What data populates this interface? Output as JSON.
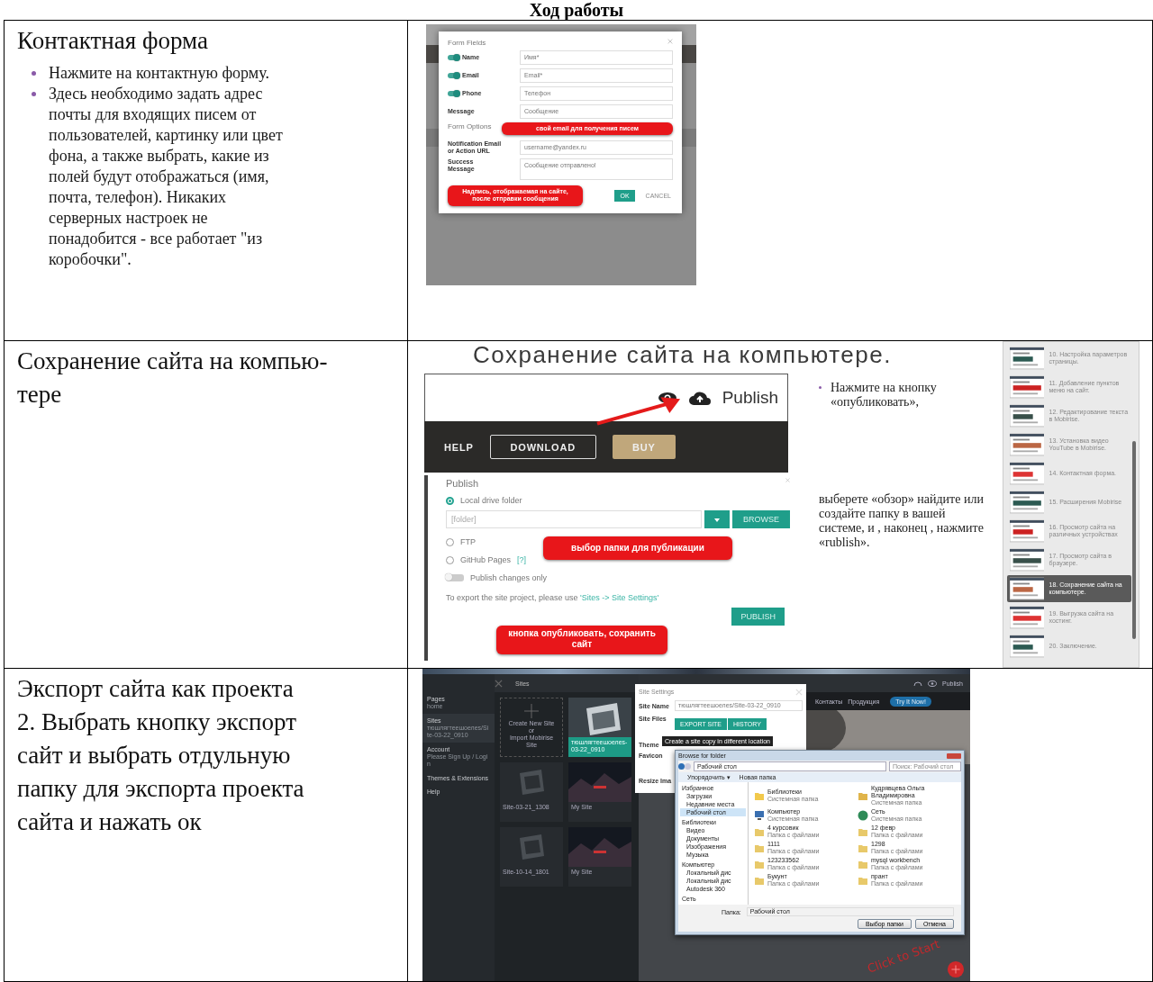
{
  "heading": "Ход работы",
  "contact_row": {
    "title": "Контактная форма",
    "bullets": [
      "Нажмите на контактную форму.",
      "Здесь необходимо задать адрес почты для входящих писем от пользователей, картинку или цвет фона, а также выбрать, какие из полей будут отображаться (имя, почта, телефон). Никаких серверных настроек не понадобится - все работает \"из коробочки\"."
    ],
    "form_dialog": {
      "title": "Form Fields",
      "fields": [
        {
          "kind": "toggle",
          "on": true,
          "label": "Name",
          "value": "Имя*"
        },
        {
          "kind": "toggle",
          "on": true,
          "label": "Email",
          "value": "Email*"
        },
        {
          "kind": "toggle",
          "on": true,
          "label": "Phone",
          "value": "Телефон"
        },
        {
          "kind": "plain",
          "label": "Message",
          "value": "Сообщение"
        }
      ],
      "options_title": "Form Options",
      "notification_label": "Notification Email or Action URL",
      "notification_value": "username@yandex.ru",
      "success_label": "Success Message",
      "success_value": "Сообщение отправлено!",
      "ok": "OK",
      "cancel": "CANCEL"
    },
    "callouts": [
      "свой email для получения писем",
      "Надпись, отображаемая на сайте, после отправки сообщения"
    ]
  },
  "save_row": {
    "title": "Сохранение сайта на компью-\nтере",
    "slide_title": "Сохранение сайта на компьютере.",
    "toolbar_label": "Publish",
    "nav": [
      {
        "kind": "link",
        "label": "HELP"
      },
      {
        "kind": "outline",
        "label": "DOWNLOAD"
      },
      {
        "kind": "filled",
        "label": "BUY"
      }
    ],
    "publish_dialog": {
      "title": "Publish",
      "options": [
        {
          "label": "Local drive folder",
          "selected": true
        },
        {
          "label": "FTP",
          "selected": false
        },
        {
          "label": "GitHub Pages",
          "selected": false,
          "help": "[?]"
        }
      ],
      "folder_placeholder": "[folder]",
      "browse": "BROWSE",
      "changes_only": {
        "label": "Publish changes only",
        "on": false
      },
      "note": "To export the site project, please use ",
      "note_link": "'Sites -> Site Settings'",
      "publish": "PUBLISH"
    },
    "callouts": [
      "выбор папки для публикации",
      "кнопка опубликовать, сохранить сайт"
    ],
    "slide_bullet": "Нажмите на кнопку «опубликовать»,",
    "slide_text": "выберете «обзор» найдите или создайте папку в вашей системе, и , наконец , нажмите «rublish».",
    "slides": [
      {
        "label": "10. Настройка параметров страницы.",
        "selected": false
      },
      {
        "label": "11. Добавление пунктов меню на сайт.",
        "selected": false
      },
      {
        "label": "12. Редактирование текста в Mobirise.",
        "selected": false
      },
      {
        "label": "13. Установка видео YouTube в Mobirise.",
        "selected": false
      },
      {
        "label": "14. Контактная форма.",
        "selected": false
      },
      {
        "label": "15. Расширения Mobirise",
        "selected": false
      },
      {
        "label": "16. Просмотр сайта на различных устройствах",
        "selected": false
      },
      {
        "label": "17. Просмотр сайта в браузере.",
        "selected": false
      },
      {
        "label": "18. Сохранение сайта на компьютере.",
        "selected": true
      },
      {
        "label": "19. Выгрузка сайта на хостинг.",
        "selected": false
      },
      {
        "label": "20. Заключение.",
        "selected": false
      }
    ]
  },
  "export_row": {
    "title": "Экспорт сайта как проекта\n2. Выбрать кнопку экспорт\nсайт и выбрать отдульную\nпапку для экспорта проекта\nсайта и нажать ок",
    "menu": [
      {
        "label": "Pages",
        "sub": "home",
        "selected": false
      },
      {
        "label": "Sites",
        "sub": "тюшлягтеешоелеs/Site-03-22_0910",
        "selected": true
      },
      {
        "label": "Account",
        "sub": "Please Sign Up / Login",
        "selected": false
      },
      {
        "label": "Themes & Extensions",
        "selected": false
      },
      {
        "label": "Help",
        "selected": false
      }
    ],
    "panel_title": "Sites",
    "create_label": "Create New Site",
    "create_or": "or",
    "import_label": "Import Mobirise Site",
    "sites": [
      {
        "kind": "current",
        "name": "тюшлягтеешоелеs-03-22_0910"
      },
      {
        "kind": "blank",
        "name": "Site-03-21_1308"
      },
      {
        "kind": "template",
        "name": "My Site"
      },
      {
        "kind": "blank",
        "name": "Site-10-14_1801"
      },
      {
        "kind": "template",
        "name": "My Site"
      }
    ],
    "topbar_publish": "Publish",
    "site_nav": [
      "Контакты",
      "Продукция"
    ],
    "cta": "Try It Now!",
    "settings": {
      "title": "Site Settings",
      "name_label": "Site Name",
      "name_value": "тюшлягтеешоелеs/Site-03-22_0910",
      "files_label": "Site Files",
      "export": "EXPORT SITE",
      "history": "HISTORY",
      "tooltip": "Create a site copy in different location",
      "theme_label": "Theme",
      "favicon_label": "Favicon",
      "resize_label": "Resize Ima"
    },
    "browse": {
      "title": "Browse for folder",
      "address": "Рабочий стол",
      "search": "Поиск: Рабочий стол",
      "organize": "Упорядочить ▾",
      "new_folder": "Новая папка",
      "tree": [
        {
          "label": "Избранное",
          "selected": false,
          "children": [
            {
              "label": "Загрузки",
              "selected": false
            },
            {
              "label": "Недавние места",
              "selected": false
            },
            {
              "label": "Рабочий стол",
              "selected": true
            }
          ]
        },
        {
          "label": "Библиотеки",
          "selected": false,
          "children": [
            {
              "label": "Видео",
              "selected": false
            },
            {
              "label": "Документы",
              "selected": false
            },
            {
              "label": "Изображения",
              "selected": false
            },
            {
              "label": "Музыка",
              "selected": false
            }
          ]
        },
        {
          "label": "Компьютер",
          "selected": false,
          "children": [
            {
              "label": "Локальный дис",
              "selected": false
            },
            {
              "label": "Локальный дис",
              "selected": false
            },
            {
              "label": "Autodesk 360",
              "selected": false
            }
          ]
        },
        {
          "label": "Сеть",
          "selected": false
        }
      ],
      "items": [
        {
          "kind": "library",
          "name": "Библиотеки",
          "type": "Системная папка"
        },
        {
          "kind": "user",
          "name": "Кудрявцева Ольга Владимировна",
          "type": "Системная папка"
        },
        {
          "kind": "computer",
          "name": "Компьютер",
          "type": "Системная папка"
        },
        {
          "kind": "network",
          "name": "Сеть",
          "type": "Системная папка"
        },
        {
          "kind": "folder",
          "name": "4 курсовик",
          "type": "Папка с файлами"
        },
        {
          "kind": "folder",
          "name": "12 февр",
          "type": "Папка с файлами"
        },
        {
          "kind": "folder",
          "name": "1111",
          "type": "Папка с файлами"
        },
        {
          "kind": "folder",
          "name": "1298",
          "type": "Папка с файлами"
        },
        {
          "kind": "folder",
          "name": "123233562",
          "type": "Папка с файлами"
        },
        {
          "kind": "folder",
          "name": "mysql workbench",
          "type": "Папка с файлами"
        },
        {
          "kind": "folder",
          "name": "Букунт",
          "type": "Папка с файлами"
        },
        {
          "kind": "folder",
          "name": "прант",
          "type": "Папка с файлами"
        }
      ],
      "folder_label": "Папка:",
      "folder_value": "Рабочий стол",
      "ok": "Выбор папки",
      "cancel": "Отмена"
    },
    "hint": "Click to Start"
  }
}
